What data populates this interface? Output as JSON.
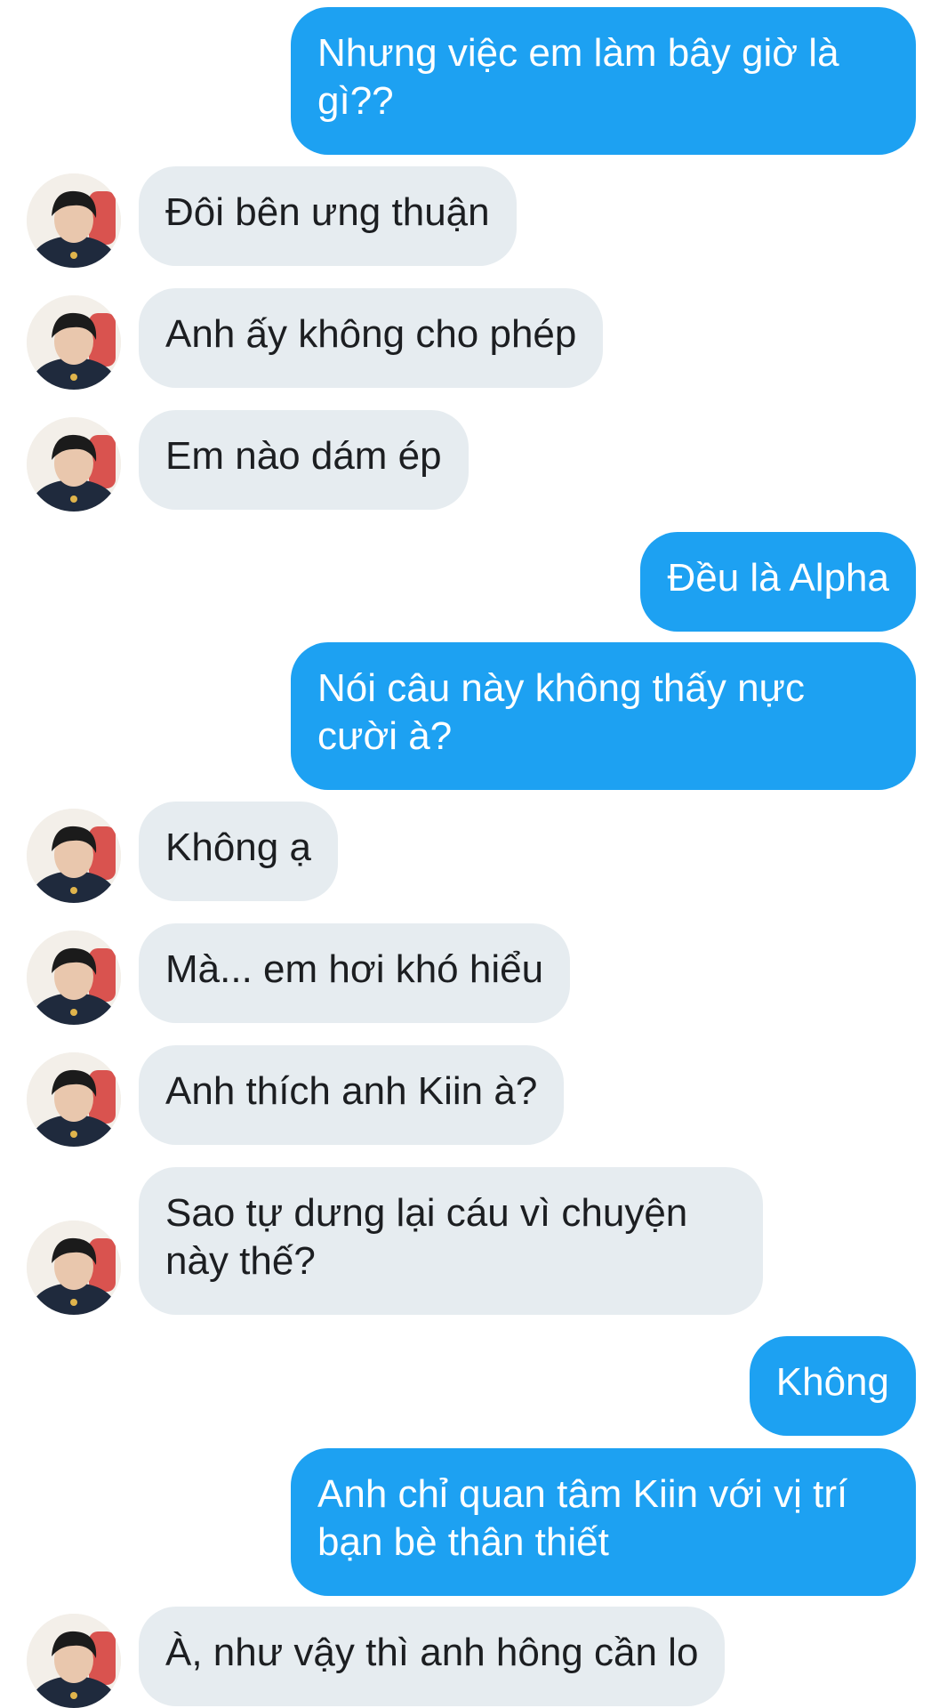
{
  "conversation": {
    "messages": [
      {
        "sender": "me",
        "text": "Nhưng việc em làm bây giờ là gì??"
      },
      {
        "sender": "other",
        "text": "Đôi bên ưng thuận"
      },
      {
        "sender": "other",
        "text": "Anh ấy không cho phép"
      },
      {
        "sender": "other",
        "text": "Em nào dám ép"
      },
      {
        "sender": "me",
        "text": "Đều là Alpha"
      },
      {
        "sender": "me",
        "text": "Nói câu này không thấy nực cười à?"
      },
      {
        "sender": "other",
        "text": "Không ạ"
      },
      {
        "sender": "other",
        "text": "Mà... em hơi khó hiểu"
      },
      {
        "sender": "other",
        "text": "Anh thích anh Kiin à?"
      },
      {
        "sender": "other",
        "text": "Sao tự dưng lại cáu vì chuyện này thế?"
      },
      {
        "sender": "me",
        "text": "Không"
      },
      {
        "sender": "me",
        "text": "Anh chỉ quan tâm Kiin với vị trí bạn bè thân thiết"
      },
      {
        "sender": "other",
        "text": "À, như vậy thì anh hông cần lo"
      }
    ]
  },
  "colors": {
    "outgoing_bubble": "#1da1f2",
    "incoming_bubble": "#e6ecf0",
    "background": "#ffffff"
  },
  "icons": {
    "contact_avatar": "avatar"
  }
}
